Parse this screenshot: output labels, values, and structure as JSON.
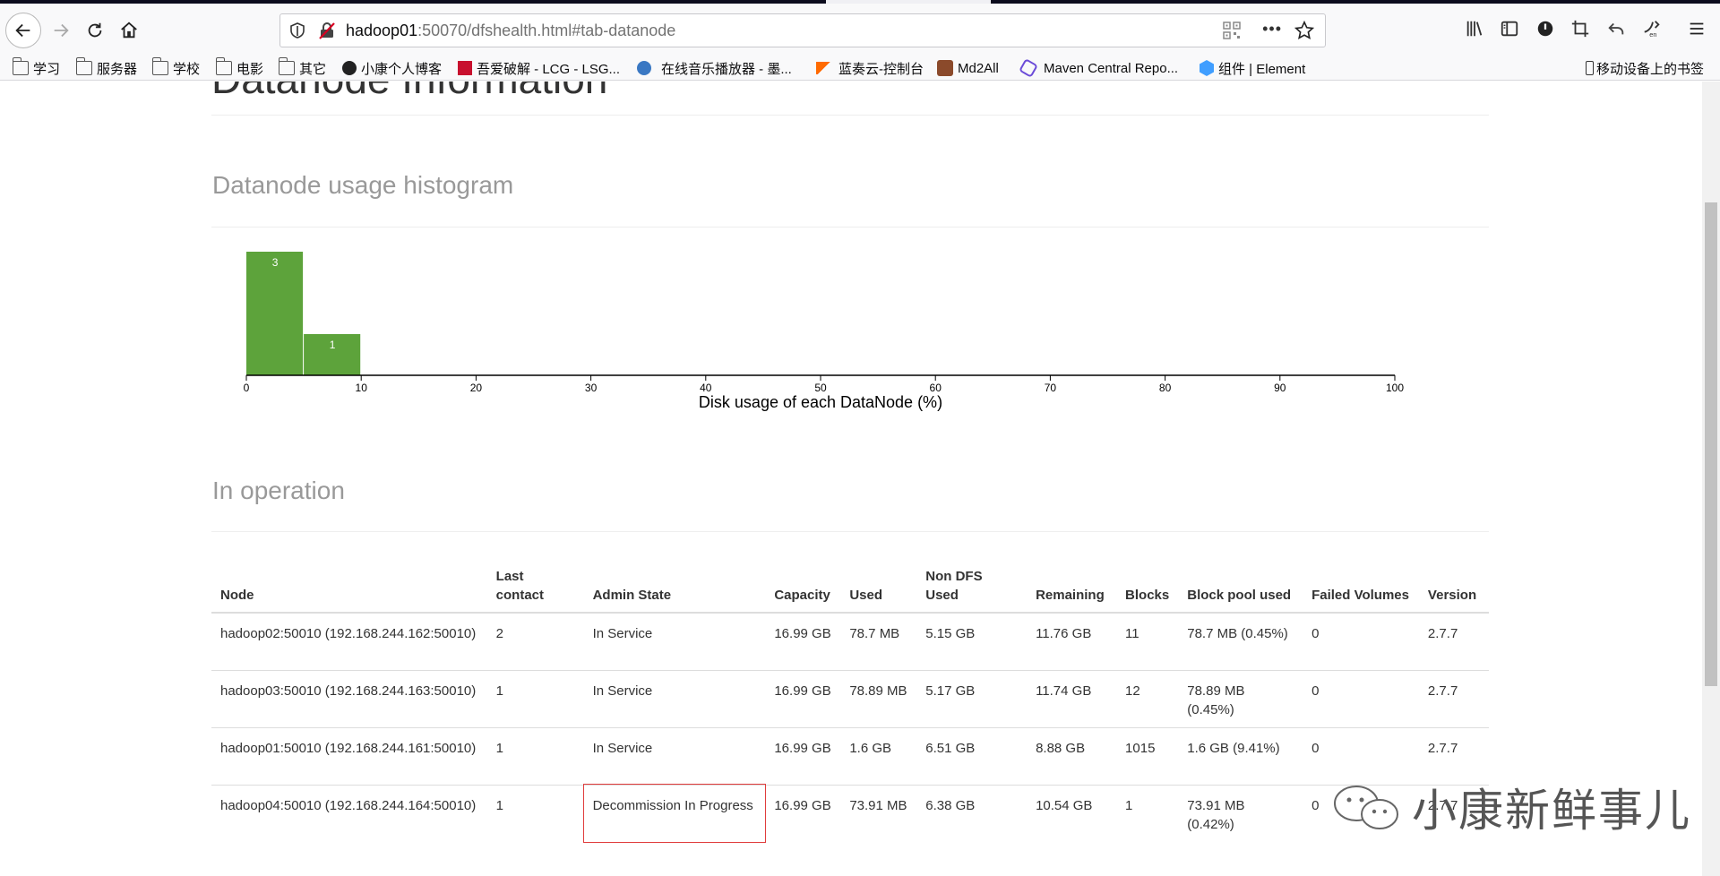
{
  "browser": {
    "url_host": "hadoop01",
    "url_rest": ":50070/dfshealth.html#tab-datanode"
  },
  "bookmarks": [
    {
      "label": "学习",
      "icon": "folder-icon"
    },
    {
      "label": "服务器",
      "icon": "folder-icon"
    },
    {
      "label": "学校",
      "icon": "folder-icon"
    },
    {
      "label": "电影",
      "icon": "folder-icon"
    },
    {
      "label": "其它",
      "icon": "folder-icon"
    },
    {
      "label": "小康个人博客",
      "icon": "site-icon"
    },
    {
      "label": "吾爱破解 - LCG - LSG...",
      "icon": "site-icon"
    },
    {
      "label": "在线音乐播放器 - 墨...",
      "icon": "globe-icon"
    },
    {
      "label": "蓝奏云-控制台",
      "icon": "site-icon"
    },
    {
      "label": "Md2All",
      "icon": "site-icon"
    },
    {
      "label": "Maven Central Repo...",
      "icon": "site-icon"
    },
    {
      "label": "组件 | Element",
      "icon": "site-icon"
    },
    {
      "label": "移动设备上的书签",
      "icon": "mobile-icon"
    }
  ],
  "page": {
    "cut_heading": "Datanode Information",
    "histogram_title": "Datanode usage histogram",
    "operation_title": "In operation"
  },
  "chart_data": {
    "type": "bar",
    "xlabel": "Disk usage of each DataNode (%)",
    "ylabel": "",
    "x_ticks": [
      0,
      10,
      20,
      30,
      40,
      50,
      60,
      70,
      80,
      90,
      100
    ],
    "xlim": [
      0,
      100
    ],
    "bins": [
      {
        "from": 0,
        "to": 5,
        "count": 3
      },
      {
        "from": 5,
        "to": 10,
        "count": 1
      }
    ],
    "bar_color": "#5da33b"
  },
  "table": {
    "headers": [
      "Node",
      "Last contact",
      "Admin State",
      "Capacity",
      "Used",
      "Non DFS Used",
      "Remaining",
      "Blocks",
      "Block pool used",
      "Failed Volumes",
      "Version"
    ],
    "rows": [
      [
        "hadoop02:50010 (192.168.244.162:50010)",
        "2",
        "In Service",
        "16.99 GB",
        "78.7 MB",
        "5.15 GB",
        "11.76 GB",
        "11",
        "78.7 MB (0.45%)",
        "0",
        "2.7.7"
      ],
      [
        "hadoop03:50010 (192.168.244.163:50010)",
        "1",
        "In Service",
        "16.99 GB",
        "78.89 MB",
        "5.17 GB",
        "11.74 GB",
        "12",
        "78.89 MB (0.45%)",
        "0",
        "2.7.7"
      ],
      [
        "hadoop01:50010 (192.168.244.161:50010)",
        "1",
        "In Service",
        "16.99 GB",
        "1.6 GB",
        "6.51 GB",
        "8.88 GB",
        "1015",
        "1.6 GB (9.41%)",
        "0",
        "2.7.7"
      ],
      [
        "hadoop04:50010 (192.168.244.164:50010)",
        "1",
        "Decommission In Progress",
        "16.99 GB",
        "73.91 MB",
        "6.38 GB",
        "10.54 GB",
        "1",
        "73.91 MB (0.42%)",
        "0",
        "2.7.7"
      ]
    ]
  },
  "watermark": "小康新鲜事儿"
}
